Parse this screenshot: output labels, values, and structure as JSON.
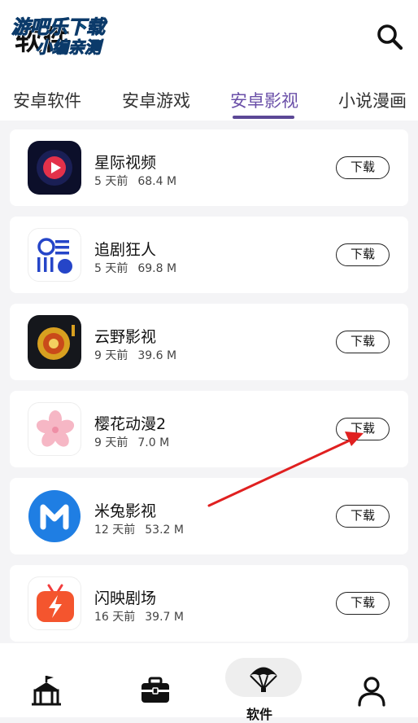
{
  "header": {
    "title": "软件",
    "watermark_line1": "游吧乐下载",
    "watermark_line2": "小编亲测"
  },
  "tabs": [
    {
      "label": "安卓软件",
      "active": false
    },
    {
      "label": "安卓游戏",
      "active": false
    },
    {
      "label": "安卓影视",
      "active": true
    },
    {
      "label": "小说漫画",
      "active": false
    }
  ],
  "apps": [
    {
      "name": "星际视频",
      "time": "5 天前",
      "size": "68.4 M",
      "button": "下载"
    },
    {
      "name": "追剧狂人",
      "time": "5 天前",
      "size": "69.8 M",
      "button": "下载"
    },
    {
      "name": "云野影视",
      "time": "9 天前",
      "size": "39.6 M",
      "button": "下载"
    },
    {
      "name": "樱花动漫2",
      "time": "9 天前",
      "size": "7.0 M",
      "button": "下载"
    },
    {
      "name": "米兔影视",
      "time": "12 天前",
      "size": "53.2 M",
      "button": "下载"
    },
    {
      "name": "闪映剧场",
      "time": "16 天前",
      "size": "39.7 M",
      "button": "下载"
    }
  ],
  "bottom_nav": {
    "items": [
      {
        "icon": "circus-tent-icon"
      },
      {
        "icon": "toolbox-icon"
      },
      {
        "icon": "parachute-icon",
        "label": "软件",
        "active": true
      },
      {
        "icon": "person-icon"
      }
    ]
  },
  "colors": {
    "accent": "#5c4896",
    "annotation_arrow": "#e02020",
    "watermark": "#17d1ec"
  }
}
